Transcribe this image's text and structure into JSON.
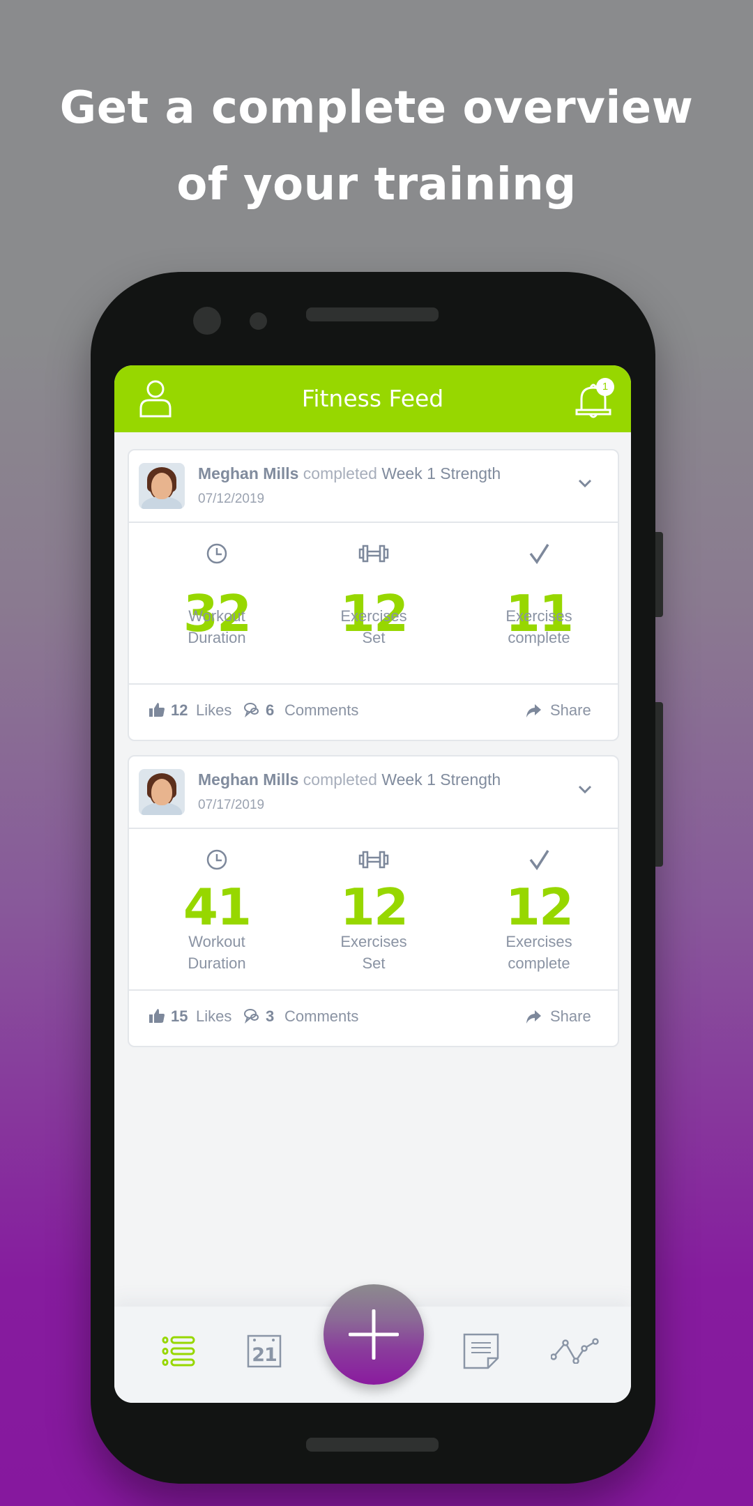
{
  "headline": {
    "line1": "Get a complete overview",
    "line2": "of your training"
  },
  "appbar": {
    "title": "Fitness Feed",
    "notification_count": "1",
    "left_icon": "profile-icon",
    "right_icon": "bell-icon"
  },
  "colors": {
    "accent": "#97d700",
    "text_muted": "#8a93a3",
    "fab_gradient_end": "#8a1a9f"
  },
  "feed": [
    {
      "user": "Meghan Mills",
      "verb": "completed",
      "workout": "Week 1 Strength",
      "date": "07/12/2019",
      "stats": [
        {
          "icon": "clock-icon",
          "value": "32",
          "label_line1": "Workout",
          "label_line2": "Duration"
        },
        {
          "icon": "dumbbell-icon",
          "value": "12",
          "label_line1": "Exercises",
          "label_line2": "Set"
        },
        {
          "icon": "checkmark-icon",
          "value": "11",
          "label_line1": "Exercises",
          "label_line2": "complete"
        }
      ],
      "likes_count": "12",
      "likes_label": "Likes",
      "comments_count": "6",
      "comments_label": "Comments",
      "share_label": "Share"
    },
    {
      "user": "Meghan Mills",
      "verb": "completed",
      "workout": "Week 1 Strength",
      "date": "07/17/2019",
      "stats": [
        {
          "icon": "clock-icon",
          "value": "41",
          "label_line1": "Workout",
          "label_line2": "Duration"
        },
        {
          "icon": "dumbbell-icon",
          "value": "12",
          "label_line1": "Exercises",
          "label_line2": "Set"
        },
        {
          "icon": "checkmark-icon",
          "value": "12",
          "label_line1": "Exercises",
          "label_line2": "complete"
        }
      ],
      "likes_count": "15",
      "likes_label": "Likes",
      "comments_count": "3",
      "comments_label": "Comments",
      "share_label": "Share"
    }
  ],
  "tabbar": {
    "items": [
      {
        "icon": "list-icon",
        "active": true
      },
      {
        "icon": "calendar-icon",
        "day": "21",
        "active": false
      },
      {
        "icon": "plus-icon",
        "fab": true
      },
      {
        "icon": "notes-icon",
        "active": false
      },
      {
        "icon": "line-chart-icon",
        "active": false
      }
    ]
  }
}
